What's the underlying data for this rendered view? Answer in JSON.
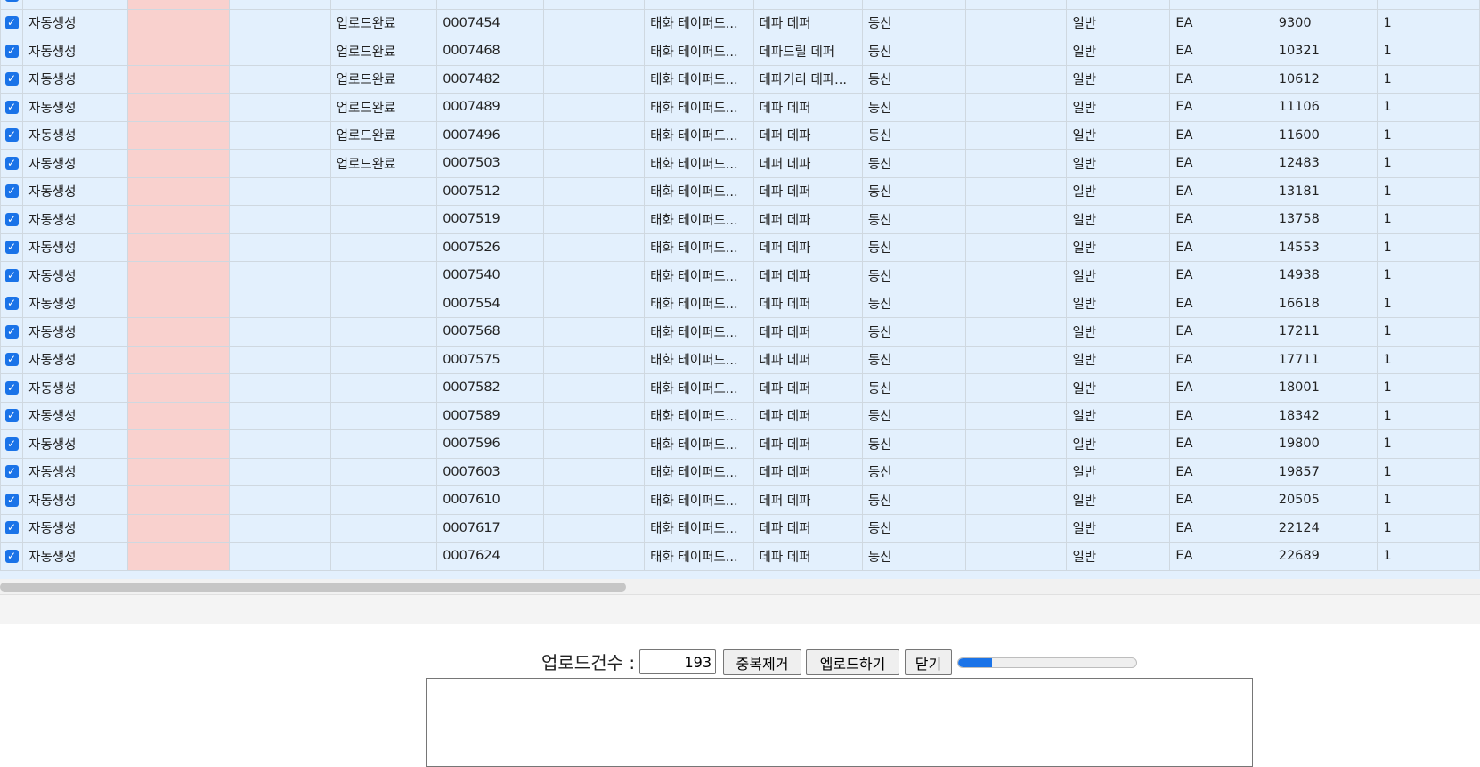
{
  "columns": [
    {
      "key": "check"
    },
    {
      "key": "gen"
    },
    {
      "key": "pink"
    },
    {
      "key": "blank1"
    },
    {
      "key": "status"
    },
    {
      "key": "code"
    },
    {
      "key": "blank2"
    },
    {
      "key": "vendor"
    },
    {
      "key": "item"
    },
    {
      "key": "maker"
    },
    {
      "key": "blank3"
    },
    {
      "key": "type"
    },
    {
      "key": "unit"
    },
    {
      "key": "num"
    },
    {
      "key": "extra"
    }
  ],
  "rows": [
    {
      "gen": "",
      "status": "",
      "code": "",
      "vendor": "",
      "item": "",
      "maker": "",
      "type": "",
      "unit": "",
      "num": "",
      "extra": ""
    },
    {
      "gen": "자동생성",
      "status": "업로드완료",
      "code": "0007454",
      "vendor": "태화 테이퍼드...",
      "item": "데파 데퍼",
      "maker": "동신",
      "type": "일반",
      "unit": "EA",
      "num": "9300",
      "extra": "1"
    },
    {
      "gen": "자동생성",
      "status": "업로드완료",
      "code": "0007468",
      "vendor": "태화 테이퍼드...",
      "item": "데파드릴 데퍼",
      "maker": "동신",
      "type": "일반",
      "unit": "EA",
      "num": "10321",
      "extra": "1"
    },
    {
      "gen": "자동생성",
      "status": "업로드완료",
      "code": "0007482",
      "vendor": "태화 테이퍼드...",
      "item": "데파기리 데파...",
      "maker": "동신",
      "type": "일반",
      "unit": "EA",
      "num": "10612",
      "extra": "1"
    },
    {
      "gen": "자동생성",
      "status": "업로드완료",
      "code": "0007489",
      "vendor": "태화 테이퍼드...",
      "item": "데파 데퍼",
      "maker": "동신",
      "type": "일반",
      "unit": "EA",
      "num": "11106",
      "extra": "1"
    },
    {
      "gen": "자동생성",
      "status": "업로드완료",
      "code": "0007496",
      "vendor": "태화 테이퍼드...",
      "item": "데퍼 데파",
      "maker": "동신",
      "type": "일반",
      "unit": "EA",
      "num": "11600",
      "extra": "1"
    },
    {
      "gen": "자동생성",
      "status": "업로드완료",
      "code": "0007503",
      "vendor": "태화 테이퍼드...",
      "item": "데퍼 데파",
      "maker": "동신",
      "type": "일반",
      "unit": "EA",
      "num": "12483",
      "extra": "1"
    },
    {
      "gen": "자동생성",
      "status": "",
      "code": "0007512",
      "vendor": "태화 테이퍼드...",
      "item": "데파 데퍼",
      "maker": "동신",
      "type": "일반",
      "unit": "EA",
      "num": "13181",
      "extra": "1"
    },
    {
      "gen": "자동생성",
      "status": "",
      "code": "0007519",
      "vendor": "태화 테이퍼드...",
      "item": "데퍼 데파",
      "maker": "동신",
      "type": "일반",
      "unit": "EA",
      "num": "13758",
      "extra": "1"
    },
    {
      "gen": "자동생성",
      "status": "",
      "code": "0007526",
      "vendor": "태화 테이퍼드...",
      "item": "데퍼 데파",
      "maker": "동신",
      "type": "일반",
      "unit": "EA",
      "num": "14553",
      "extra": "1"
    },
    {
      "gen": "자동생성",
      "status": "",
      "code": "0007540",
      "vendor": "태화 테이퍼드...",
      "item": "데퍼 데파",
      "maker": "동신",
      "type": "일반",
      "unit": "EA",
      "num": "14938",
      "extra": "1"
    },
    {
      "gen": "자동생성",
      "status": "",
      "code": "0007554",
      "vendor": "태화 테이퍼드...",
      "item": "데파 데퍼",
      "maker": "동신",
      "type": "일반",
      "unit": "EA",
      "num": "16618",
      "extra": "1"
    },
    {
      "gen": "자동생성",
      "status": "",
      "code": "0007568",
      "vendor": "태화 테이퍼드...",
      "item": "데파 데퍼",
      "maker": "동신",
      "type": "일반",
      "unit": "EA",
      "num": "17211",
      "extra": "1"
    },
    {
      "gen": "자동생성",
      "status": "",
      "code": "0007575",
      "vendor": "태화 테이퍼드...",
      "item": "데파 데퍼",
      "maker": "동신",
      "type": "일반",
      "unit": "EA",
      "num": "17711",
      "extra": "1"
    },
    {
      "gen": "자동생성",
      "status": "",
      "code": "0007582",
      "vendor": "태화 테이퍼드...",
      "item": "데파 데퍼",
      "maker": "동신",
      "type": "일반",
      "unit": "EA",
      "num": "18001",
      "extra": "1"
    },
    {
      "gen": "자동생성",
      "status": "",
      "code": "0007589",
      "vendor": "태화 테이퍼드...",
      "item": "데파 데퍼",
      "maker": "동신",
      "type": "일반",
      "unit": "EA",
      "num": "18342",
      "extra": "1"
    },
    {
      "gen": "자동생성",
      "status": "",
      "code": "0007596",
      "vendor": "태화 테이퍼드...",
      "item": "데파 데퍼",
      "maker": "동신",
      "type": "일반",
      "unit": "EA",
      "num": "19800",
      "extra": "1"
    },
    {
      "gen": "자동생성",
      "status": "",
      "code": "0007603",
      "vendor": "태화 테이퍼드...",
      "item": "데파 데퍼",
      "maker": "동신",
      "type": "일반",
      "unit": "EA",
      "num": "19857",
      "extra": "1"
    },
    {
      "gen": "자동생성",
      "status": "",
      "code": "0007610",
      "vendor": "태화 테이퍼드...",
      "item": "데퍼 데파",
      "maker": "동신",
      "type": "일반",
      "unit": "EA",
      "num": "20505",
      "extra": "1"
    },
    {
      "gen": "자동생성",
      "status": "",
      "code": "0007617",
      "vendor": "태화 테이퍼드...",
      "item": "데파 데퍼",
      "maker": "동신",
      "type": "일반",
      "unit": "EA",
      "num": "22124",
      "extra": "1"
    },
    {
      "gen": "자동생성",
      "status": "",
      "code": "0007624",
      "vendor": "태화 테이퍼드...",
      "item": "데파 데퍼",
      "maker": "동신",
      "type": "일반",
      "unit": "EA",
      "num": "22689",
      "extra": "1"
    }
  ],
  "checkbox_icon": "check-icon",
  "controls": {
    "count_label": "업로드건수 :",
    "count_value": "193",
    "dedupe_label": "중복제거",
    "upload_label": "엡로드하기",
    "close_label": "닫기",
    "progress_fraction": 0.19
  },
  "colors": {
    "row_bg": "#e3f0fd",
    "pink_cell": "#f9d1ce",
    "accent": "#1a73e8"
  }
}
